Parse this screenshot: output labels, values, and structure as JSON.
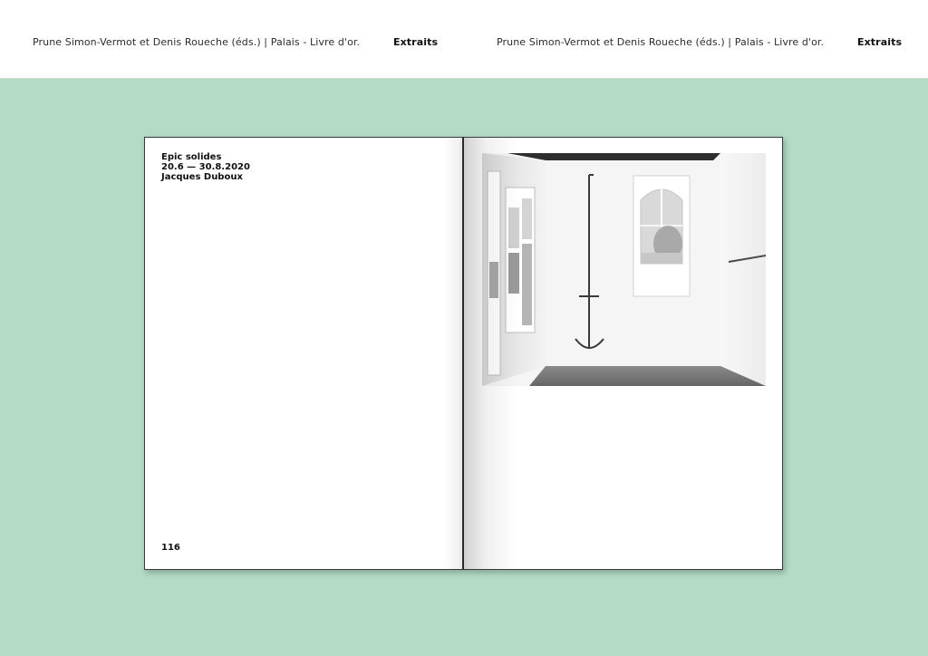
{
  "header": {
    "left": {
      "credit": "Prune Simon-Vermot et Denis Roueche (éds.)  |  Palais - Livre d'or.",
      "section": "Extraits"
    },
    "right": {
      "credit": "Prune Simon-Vermot et Denis Roueche (éds.)  |  Palais - Livre d'or.",
      "section": "Extraits"
    }
  },
  "book": {
    "left_page": {
      "title": "Epic solides",
      "dates": "20.6 — 30.8.2020",
      "artist": "Jacques Duboux",
      "page_number": "116"
    },
    "right_page": {
      "photo_icon": "installation-photo"
    }
  },
  "colors": {
    "background": "#b3dbc6",
    "header": "#ffffff",
    "page": "#ffffff",
    "text": "#111111"
  }
}
